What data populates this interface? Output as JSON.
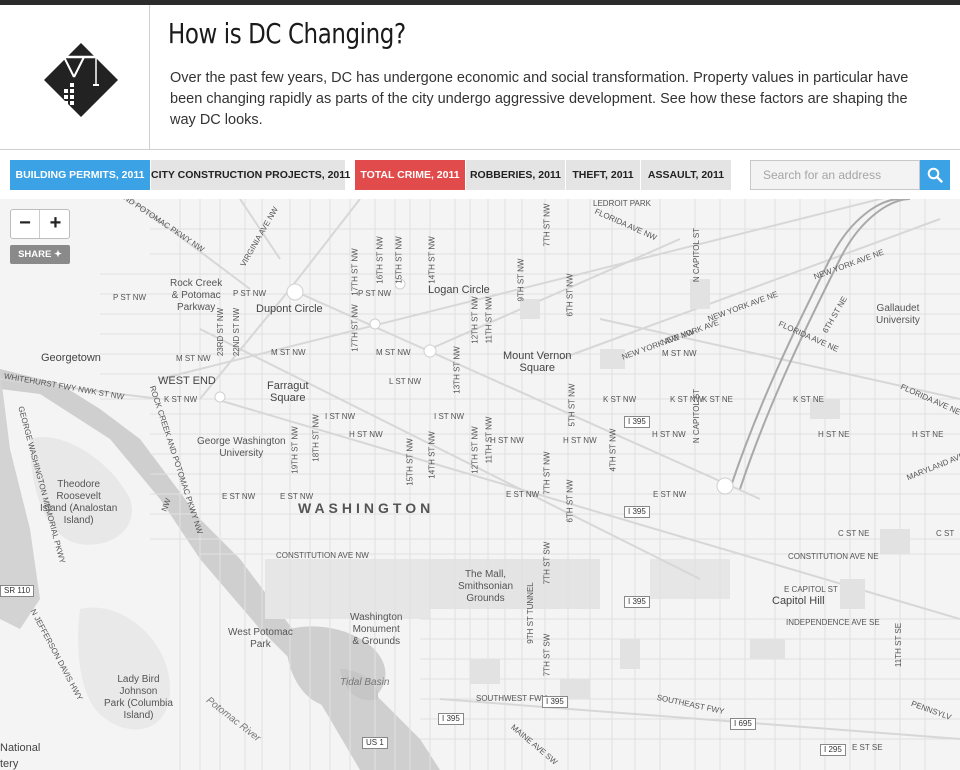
{
  "header": {
    "title": "How is DC Changing?",
    "intro": "Over the past few years, DC has undergone economic and social transformation. Property values in particular have been changing rapidly as parts of the city undergo aggressive development. See how these factors are shaping the way DC looks."
  },
  "tabs": [
    {
      "label": "BUILDING PERMITS, 2011"
    },
    {
      "label": "CITY CONSTRUCTION PROJECTS, 2011"
    },
    {
      "label": "TOTAL CRIME, 2011"
    },
    {
      "label": "ROBBERIES, 2011"
    },
    {
      "label": "THEFT, 2011"
    },
    {
      "label": "ASSAULT, 2011"
    }
  ],
  "search": {
    "placeholder": "Search for an address"
  },
  "map": {
    "zoom_out": "−",
    "zoom_in": "+",
    "share": "SHARE ✦",
    "labels": {
      "washington": "WASHINGTON",
      "georgetown": "Georgetown",
      "west_end": "WEST END",
      "foggy": "Farragut\nSquare",
      "dupont": "Dupont Circle",
      "logan": "Logan Circle",
      "mount_vernon": "Mount Vernon\nSquare",
      "gwu": "George Washington\nUniversity",
      "rock_creek": "Rock Creek\n& Potomac\nParkway",
      "theodore": "Theodore\nRoosevelt\nIsland (Analostan\nIsland)",
      "mall": "The Mall,\nSmithsonian\nGrounds",
      "monument": "Washington\nMonument\n& Grounds",
      "west_potomac": "West Potomac\nPark",
      "lady_bird": "Lady Bird\nJohnson\nPark (Columbia\nIsland)",
      "capitol_hill": "Capitol Hill",
      "gallaudet": "Gallaudet\nUniversity",
      "tidal_basin": "Tidal Basin",
      "potomac_river": "Potomac River",
      "national": "National",
      "cemetery": "tery"
    },
    "streets": {
      "p_st_nw_1": "P ST NW",
      "p_st_nw_2": "P ST NW",
      "p_st_nw_3": "P ST NW",
      "m_st_nw_1": "M ST NW",
      "m_st_nw_2": "M ST NW",
      "m_st_nw_3": "M ST NW",
      "m_st_nw_4": "M ST NW",
      "l_st_nw": "L ST NW",
      "k_st_nw_1": "K ST NW",
      "k_st_nw_2": "K ST NW",
      "k_st_nw_3": "K ST NW",
      "k_st_ne_1": "K ST NE",
      "k_st_ne_2": "K ST NE",
      "i_st_nw_1": "I ST NW",
      "i_st_nw_2": "I ST NW",
      "h_st_nw_1": "H ST NW",
      "h_st_nw_2": "H ST NW",
      "h_st_nw_3": "H ST NW",
      "h_st_nw_4": "H ST NW",
      "h_st_ne_1": "H ST NE",
      "h_st_ne_2": "H ST NE",
      "e_st_nw_1": "E ST NW",
      "e_st_nw_2": "E ST NW",
      "e_st_nw_3": "E ST NW",
      "e_st_nw_4": "E ST NW",
      "c_st_ne_1": "C ST NE",
      "c_st_ne_2": "C ST",
      "constitution_nw": "CONSTITUTION AVE NW",
      "constitution_ne": "CONSTITUTION AVE NE",
      "e_capitol": "E CAPITOL ST",
      "independence": "INDEPENDENCE AVE SE",
      "southwest_fwy": "SOUTHWEST FWY",
      "southeast_fwy": "SOUTHEAST FWY",
      "florida_1": "FLORIDA AVE NW",
      "florida_2": "FLORIDA AVE NE",
      "florida_3": "FLORIDA AVE NE",
      "new_york_1": "NEW YORK AVE NW",
      "new_york_2": "NEW YORK AVE NE",
      "new_york_3": "NEW YORK AVE NE",
      "new_york_4": "NEW YORK AVE",
      "maryland": "MARYLAND AVE",
      "pennsylvania": "PENNSYLV",
      "whitehurst": "WHITEHURST FWY NWK ST NW",
      "rock_creek_pkwy": "ROCK CREEK AND POTOMAC PKWY NW",
      "gw_memorial": "GEORGE WASHINGTON MEMORIAL PKWY",
      "jefferson_davis": "N JEFFERSON DAVIS HWY",
      "maine": "MAINE AVE SW",
      "e_st_se": "E ST SE",
      "11th_se": "11TH ST SE",
      "6th_ne": "6TH ST NE",
      "tunnel": "9TH ST TUNNEL",
      "potomac_pkwy_top": "ND POTOMAC PKWY NW",
      "ledroit": "LEDROIT PARK",
      "virginia": "VIRGINIA AVE NW",
      "ave_nw": "NW",
      "23rd": "23RD ST NW",
      "22nd": "22ND ST NW",
      "19th": "19TH ST NW",
      "18th": "18TH ST NW",
      "17th_1": "17TH ST NW",
      "17th_2": "17TH ST NW",
      "16th": "16TH ST NW",
      "15th_1": "15TH ST NW",
      "15th_2": "15TH ST NW",
      "14th_1": "14TH ST NW",
      "14th_2": "14TH ST NW",
      "13th": "13TH ST NW",
      "12th_1": "12TH ST NW",
      "12th_2": "12TH ST NW",
      "11th_1": "11TH ST NW",
      "11th_2": "11TH ST NW",
      "9th": "9TH ST NW",
      "7th_1": "7TH ST NW",
      "7th_2": "7TH ST NW",
      "7th_3": "7TH ST SW",
      "7th_4": "7TH ST SW",
      "6th_1": "6TH ST NW",
      "6th_2": "6TH ST NW",
      "5th": "5TH ST NW",
      "4th": "4TH ST NW",
      "capitol_1": "N CAPITOL ST",
      "capitol_2": "N CAPITOL ST"
    },
    "shields": {
      "i395_1": "I 395",
      "i395_2": "I 395",
      "i395_3": "I 395",
      "i395_4": "I 395",
      "i395_5": "I 395",
      "i395_6": "I 395",
      "i695": "I 695",
      "i295": "I 295",
      "us1": "US 1",
      "sr110": "SR 110"
    }
  }
}
